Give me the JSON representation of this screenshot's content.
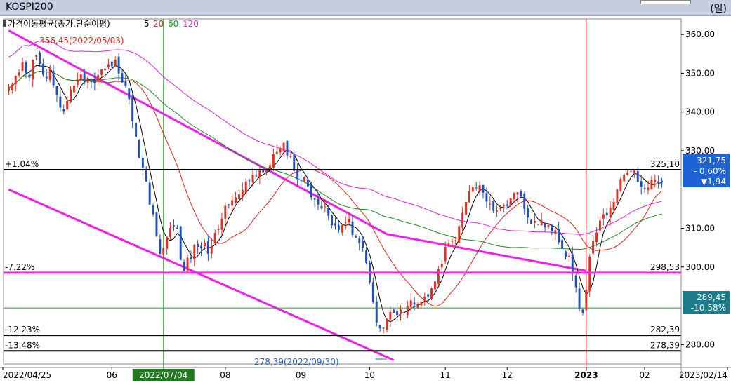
{
  "window": {
    "title": "KOSPI200",
    "unit": "(일)"
  },
  "chart_data": {
    "type": "candlestick",
    "indicator_title": "가격이동평균(종가,단순이평)",
    "ma_periods": [
      "5",
      "20",
      "60",
      "120"
    ],
    "ma_colors": [
      "#000000",
      "#e8221a",
      "#1f8a1f",
      "#e020e0"
    ],
    "candle_colors": {
      "up": "#e03020",
      "down": "#2050c0"
    },
    "ylim": [
      275,
      364
    ],
    "yticks": [
      "360.00",
      "350.00",
      "340.00",
      "330.00",
      "310.00",
      "300.00",
      "280.00"
    ],
    "x_labels": [
      "2022/04/25",
      "06",
      "2022/07/04",
      "08",
      "09",
      "10",
      "11",
      "12",
      "2023",
      "02",
      "2023/02/14"
    ],
    "closes": [
      346.2,
      347.1,
      349.3,
      350.2,
      352.8,
      350.1,
      348.9,
      353.5,
      354.6,
      352.4,
      349.6,
      348.7,
      351.2,
      346.9,
      344.4,
      341.1,
      340.2,
      342.9,
      345.8,
      346.8,
      348.3,
      349.7,
      347.9,
      348.8,
      347.7,
      347.4,
      349.5,
      351.0,
      351.2,
      352.3,
      351.8,
      353.5,
      349.9,
      347.6,
      346.8,
      343.3,
      337.6,
      333.6,
      328.1,
      325.6,
      322.1,
      316.1,
      313.6,
      308.0,
      303.4,
      304.9,
      307.8,
      310.1,
      310.5,
      309.9,
      301.8,
      299.0,
      302.4,
      302.1,
      305.7,
      305.2,
      304.8,
      306.3,
      303.4,
      305.5,
      308.8,
      309.8,
      312.5,
      315.8,
      315.9,
      317.2,
      318.0,
      318.8,
      319.9,
      322.1,
      322.2,
      323.8,
      323.4,
      325.1,
      324.5,
      325.2,
      326.3,
      329.1,
      329.7,
      330.7,
      332.0,
      328.8,
      328.6,
      324.8,
      322.7,
      322.3,
      323.2,
      320.8,
      318.0,
      317.4,
      316.1,
      315.1,
      315.6,
      313.2,
      310.8,
      310.7,
      309.6,
      310.8,
      311.6,
      312.4,
      308.3,
      307.6,
      306.2,
      305.0,
      301.1,
      296.1,
      291.0,
      285.7,
      284.2,
      284.4,
      286.6,
      288.4,
      288.2,
      287.6,
      289.0,
      288.3,
      290.0,
      291.4,
      290.3,
      290.4,
      291.1,
      292.3,
      292.4,
      294.5,
      296.3,
      299.4,
      300.9,
      305.2,
      306.1,
      306.8,
      306.9,
      310.6,
      314.0,
      316.8,
      319.6,
      320.6,
      320.4,
      321.1,
      319.2,
      316.9,
      316.3,
      314.5,
      314.6,
      315.2,
      316.0,
      315.8,
      317.7,
      319.1,
      319.3,
      318.2,
      315.0,
      312.8,
      311.0,
      311.9,
      311.1,
      312.0,
      310.2,
      310.9,
      309.2,
      309.5,
      306.4,
      304.8,
      302.6,
      302.9,
      298.3,
      294.8,
      289.2,
      288.2,
      294.2,
      302.7,
      306.7,
      308.9,
      312.0,
      313.6,
      313.4,
      315.4,
      316.8,
      320.0,
      322.7,
      323.8,
      324.4,
      324.7,
      325.0,
      322.0,
      320.6,
      320.4,
      320.5,
      322.5,
      322.6,
      321.7,
      321.75
    ],
    "levels": [
      {
        "label": "+1.04%",
        "value": 325.1,
        "value_label": "325,10",
        "color": "#000000"
      },
      {
        "label": "-7.22%",
        "value": 298.53,
        "value_label": "298,53",
        "color": "#ff20ff"
      },
      {
        "label": "-12.23%",
        "value": 282.39,
        "value_label": "282,39",
        "color": "#000000"
      },
      {
        "label": "-13.48%",
        "value": 278.39,
        "value_label": "278,39",
        "color": "#000000"
      },
      {
        "label": "",
        "value": 289.45,
        "value_label": "",
        "color": "#2a9a2a"
      }
    ],
    "annotations": {
      "high": "356,45(2022/05/03)",
      "low": "278,39(2022/09/30)"
    },
    "current": {
      "price": "321,75",
      "pct": "- 0,60%",
      "change": "▼1,94",
      "color": "#1e62d8"
    },
    "green_tag": {
      "price": "289,45",
      "pct": "-10,58%",
      "color": "#1c7c8c"
    },
    "ma_end_values": {
      "ma20": 319.2,
      "ma60": 313.1,
      "ma120": 307.9
    }
  }
}
